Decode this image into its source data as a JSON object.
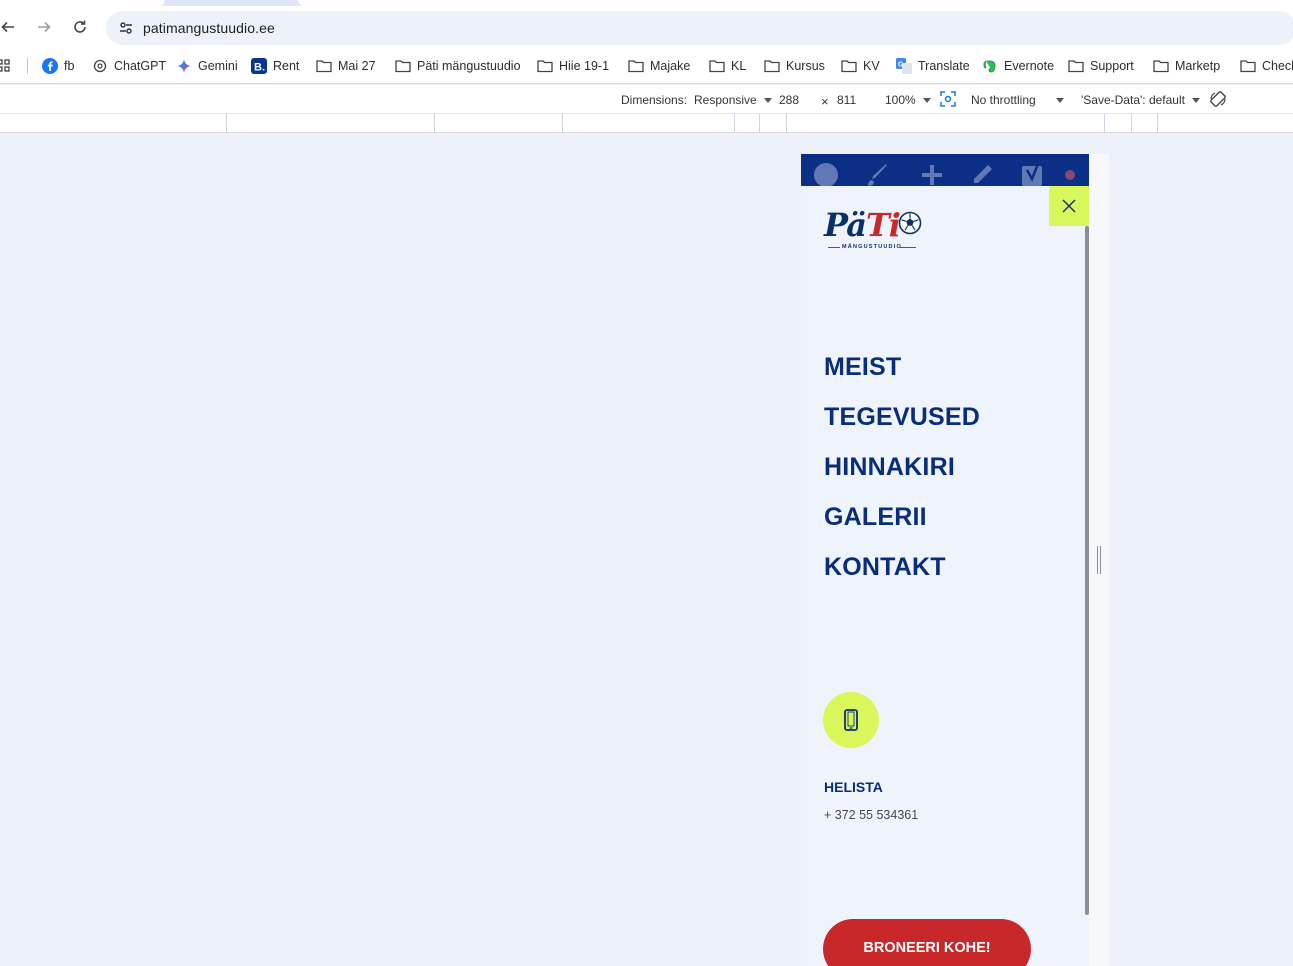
{
  "browser": {
    "url": "patimangustuudio.ee"
  },
  "bookmarks": [
    {
      "label": "fb",
      "icon": "facebook-icon"
    },
    {
      "label": "ChatGPT",
      "icon": "chatgpt-icon"
    },
    {
      "label": "Gemini",
      "icon": "gemini-icon"
    },
    {
      "label": "Rent",
      "icon": "booking-icon"
    },
    {
      "label": "Mai 27",
      "icon": "folder-icon"
    },
    {
      "label": "Päti mängustuudio",
      "icon": "folder-icon"
    },
    {
      "label": "Hiie 19-1",
      "icon": "folder-icon"
    },
    {
      "label": "Majake",
      "icon": "folder-icon"
    },
    {
      "label": "KL",
      "icon": "folder-icon"
    },
    {
      "label": "Kursus",
      "icon": "folder-icon"
    },
    {
      "label": "KV",
      "icon": "folder-icon"
    },
    {
      "label": "Translate",
      "icon": "translate-icon"
    },
    {
      "label": "Evernote",
      "icon": "evernote-icon"
    },
    {
      "label": "Support",
      "icon": "folder-icon"
    },
    {
      "label": "Marketp",
      "icon": "folder-icon"
    },
    {
      "label": "Check",
      "icon": "folder-icon"
    }
  ],
  "devtools": {
    "dimensions_label": "Dimensions:",
    "device": "Responsive",
    "width": "288",
    "times": "×",
    "height": "811",
    "zoom": "100%",
    "throttling": "No throttling",
    "save_data": "'Save-Data': default"
  },
  "site": {
    "logo_text_a": "Pä",
    "logo_text_b": "Ti",
    "logo_tag": "MÄNGUSTUUDIO",
    "menu": [
      "MEIST",
      "TEGEVUSED",
      "HINNAKIRI",
      "GALERII",
      "KONTAKT"
    ],
    "call_label": "HELISTA",
    "phone": "+ 372 55 534361",
    "cta": "BRONEERI KOHE!",
    "colors": {
      "navy": "#0a2d7a",
      "lime": "#d9f75b",
      "red": "#c8282a",
      "admin_bar": "#0b2f86"
    }
  }
}
